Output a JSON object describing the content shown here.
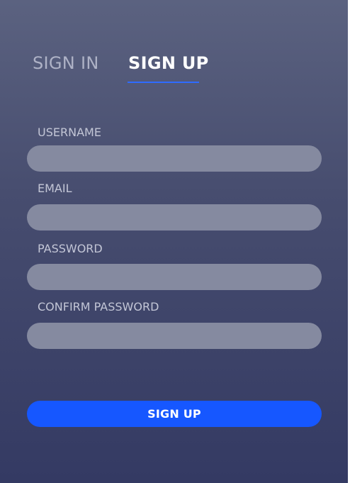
{
  "tabs": {
    "sign_in": "SIGN IN",
    "sign_up": "SIGN UP",
    "active": "sign_up"
  },
  "form": {
    "username": {
      "label": "USERNAME",
      "value": "",
      "placeholder": ""
    },
    "email": {
      "label": "EMAIL",
      "value": "",
      "placeholder": ""
    },
    "password": {
      "label": "PASSWORD",
      "value": "",
      "placeholder": ""
    },
    "confirm_password": {
      "label": "CONFIRM PASSWORD",
      "value": "",
      "placeholder": ""
    },
    "submit_label": "SIGN UP"
  },
  "colors": {
    "accent": "#1657ff",
    "tab_underline": "#2f6bff",
    "input_background": "#858aa0",
    "panel_top": "#5b6280",
    "panel_bottom": "#343a63"
  }
}
